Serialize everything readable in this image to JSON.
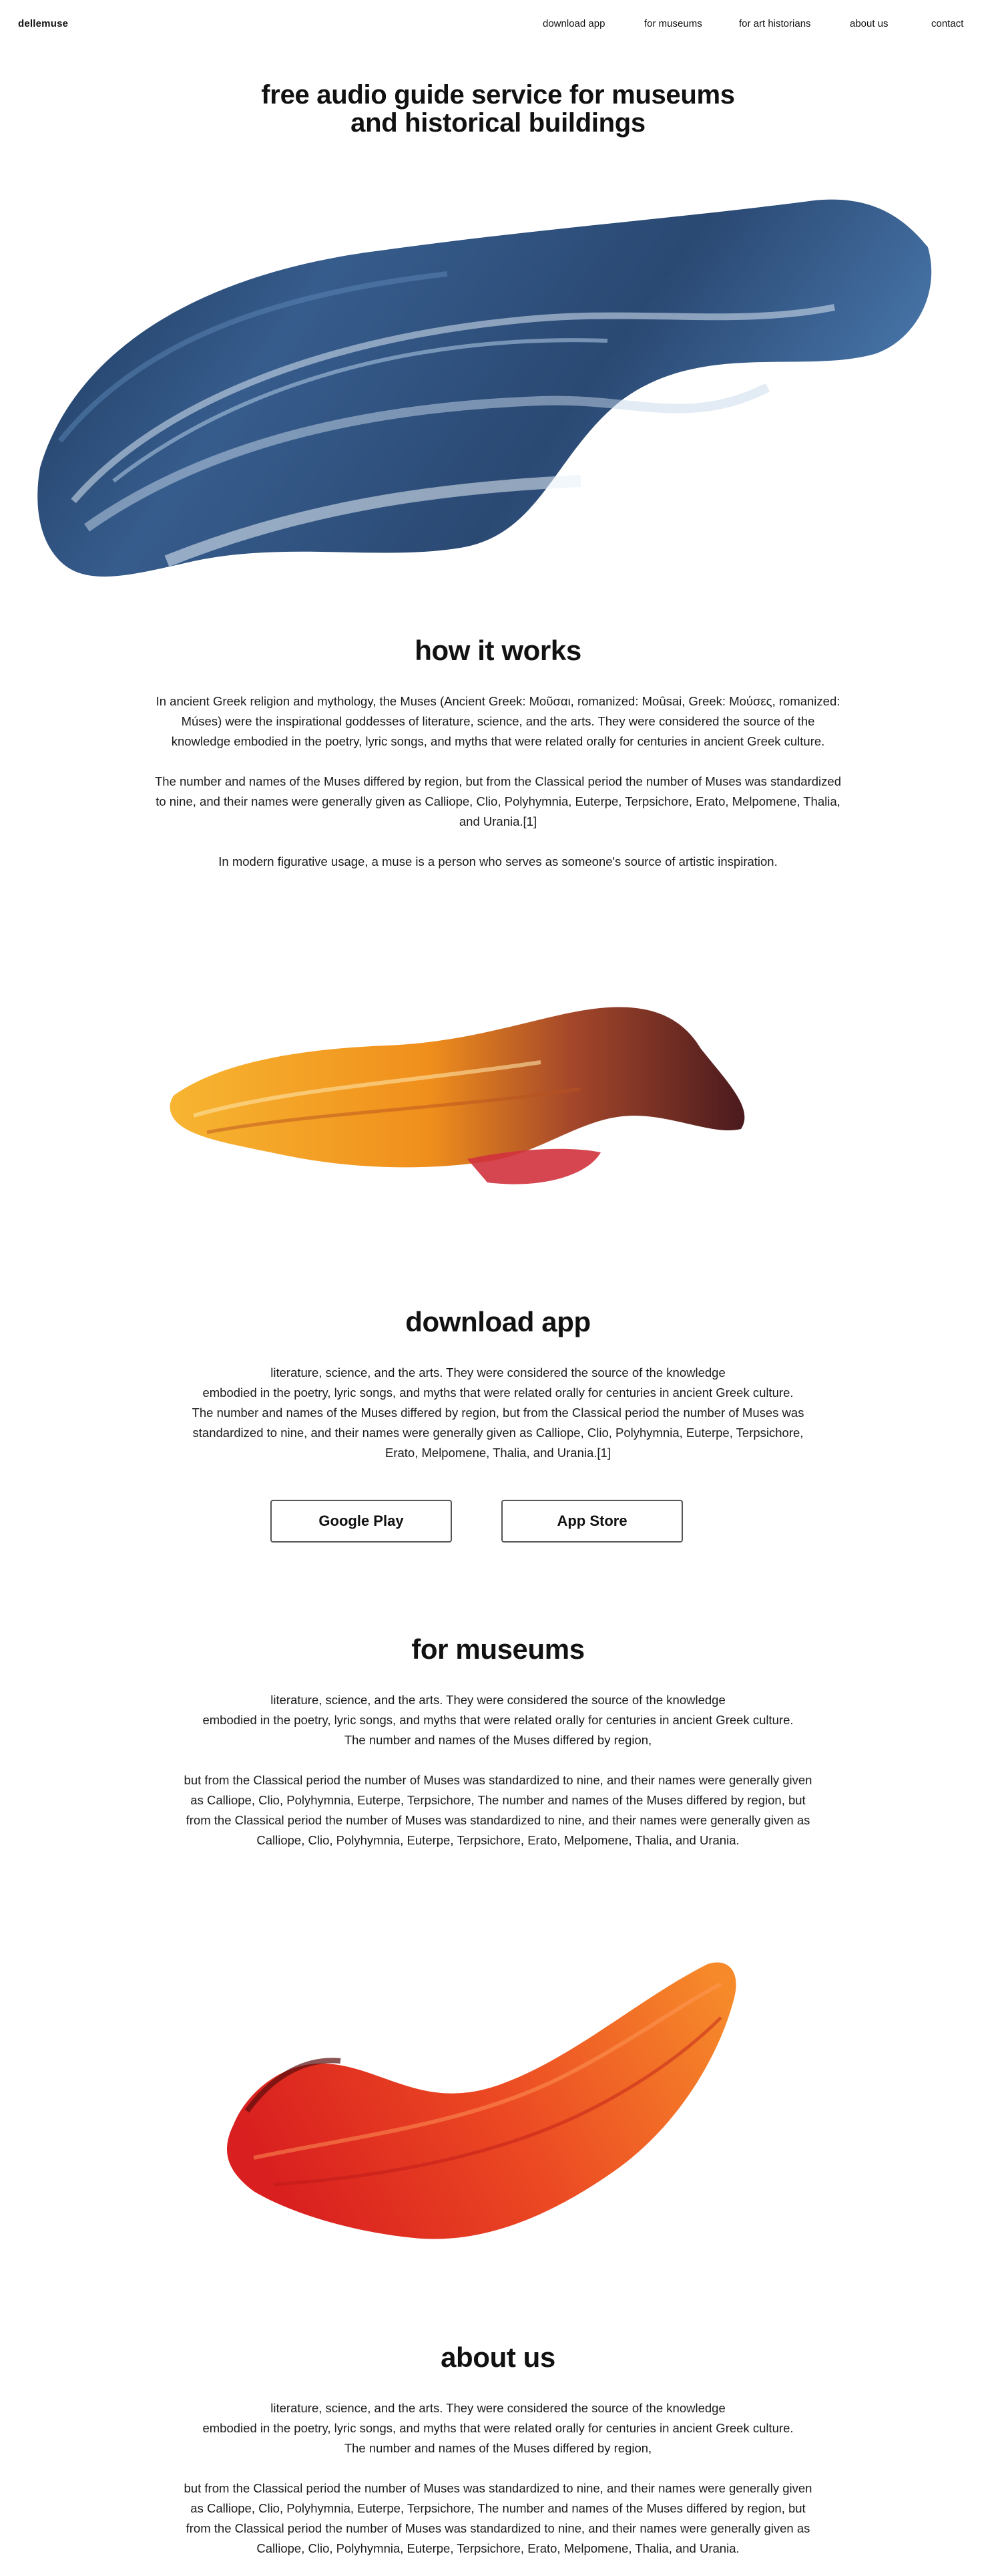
{
  "brand": {
    "logo": "dellemuse"
  },
  "nav": {
    "items": [
      {
        "label": "download app"
      },
      {
        "label": "for museums"
      },
      {
        "label": "for art historians"
      },
      {
        "label": "about us"
      },
      {
        "label": "contact"
      }
    ]
  },
  "hero": {
    "title_line1": "free audio guide service for museums",
    "title_line2": "and  historical buildings"
  },
  "how_it_works": {
    "title": "how it works",
    "paragraphs": [
      "In ancient Greek religion and mythology, the Muses (Ancient Greek: Μοῦσαι, romanized: Moûsai, Greek: Μούσες, romanized: Múses) were the inspirational goddesses of literature, science, and the arts. They were considered the source of the knowledge embodied in the poetry, lyric songs, and myths that were related orally for centuries in ancient Greek culture.",
      "The number and names of the Muses differed by region, but from the Classical period the number of Muses was standardized to nine, and their names were generally given as Calliope, Clio, Polyhymnia, Euterpe, Terpsichore, Erato, Melpomene, Thalia, and Urania.[1]",
      "In modern figurative usage, a muse is a person who serves as someone's source of artistic inspiration."
    ]
  },
  "download_app": {
    "title": "download app",
    "lines": [
      "literature, science, and the arts. They were considered the source of the knowledge",
      "embodied in the poetry, lyric songs, and myths that were related orally for centuries in ancient Greek culture.",
      "The number and names of the Muses differed by region, but from the Classical period the number of Muses was",
      "standardized to nine, and their names were generally given as Calliope, Clio, Polyhymnia, Euterpe, Terpsichore,",
      "Erato, Melpomene, Thalia, and Urania.[1]"
    ],
    "google_play_label": "Google Play",
    "app_store_label": "App Store"
  },
  "for_museums": {
    "title": "for museums",
    "block1": [
      "literature, science, and the arts. They were considered the source of the knowledge",
      "embodied in the poetry, lyric songs, and myths that were related orally for centuries in ancient Greek culture.",
      "The number and names of the Muses differed by region,"
    ],
    "block2": [
      "but from the Classical period the number of Muses was standardized to nine, and their names were generally given",
      "as Calliope, Clio, Polyhymnia, Euterpe, Terpsichore, The number and names of the Muses differed by region, but",
      "from the Classical period the number of Muses was standardized to nine, and their names were generally given as",
      "Calliope, Clio, Polyhymnia, Euterpe, Terpsichore, Erato, Melpomene, Thalia, and Urania."
    ]
  },
  "about_us": {
    "title": "about us",
    "block1": [
      "literature, science, and the arts. They were considered the source of the knowledge",
      "embodied in the poetry, lyric songs, and myths that were related orally for centuries in ancient Greek culture.",
      "The number and names of the Muses differed by region,"
    ],
    "block2": [
      "but from the Classical period the number of Muses was standardized to nine, and their names were generally given",
      "as Calliope, Clio, Polyhymnia, Euterpe, Terpsichore, The number and names of the Muses differed by region, but",
      "from the Classical period the number of Muses was standardized to nine, and their names were generally given as",
      "Calliope, Clio, Polyhymnia, Euterpe, Terpsichore, Erato, Melpomene, Thalia, and Urania."
    ]
  },
  "colors": {
    "blue_stroke": "#1f3f6b",
    "orange_stroke": "#f2a024",
    "red_stroke": "#e63a22",
    "button_border": "#555555"
  },
  "images": {
    "blue_stroke": "blue-brush-stroke",
    "orange_stroke": "orange-brush-stroke",
    "red_stroke": "red-brush-stroke"
  }
}
